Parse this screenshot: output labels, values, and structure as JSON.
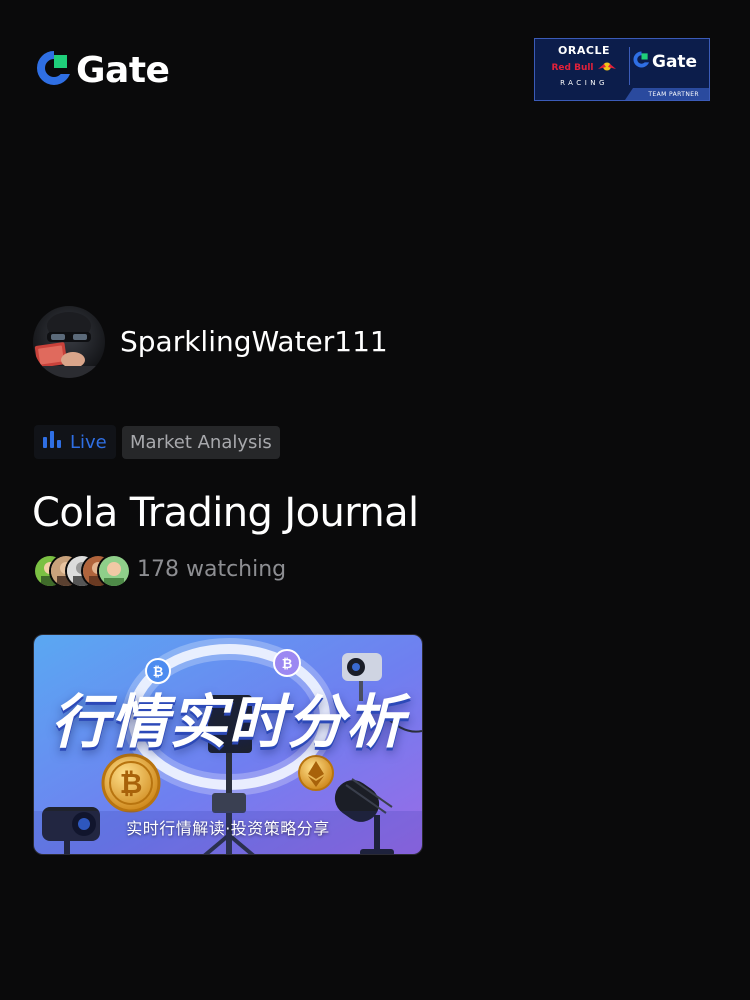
{
  "header": {
    "logo_text": "Gate",
    "brand_color": "#2f6fe4"
  },
  "partner_badge": {
    "oracle": "ORACLE",
    "red_bull": "Red Bull",
    "racing": "RACING",
    "gate": "Gate",
    "team_partner": "TEAM PARTNER"
  },
  "stream": {
    "username": "SparklingWater111",
    "live_label": "Live",
    "category": "Market Analysis",
    "title": "Cola Trading Journal",
    "watching": "178 watching"
  },
  "thumbnail": {
    "title": "行情实时分析",
    "subtitle": "实时行情解读·投资策略分享"
  },
  "colors": {
    "background": "#0a0a0b",
    "accent": "#2f6fe4",
    "muted_text": "#8d8e92",
    "tag_background": "#262729"
  }
}
